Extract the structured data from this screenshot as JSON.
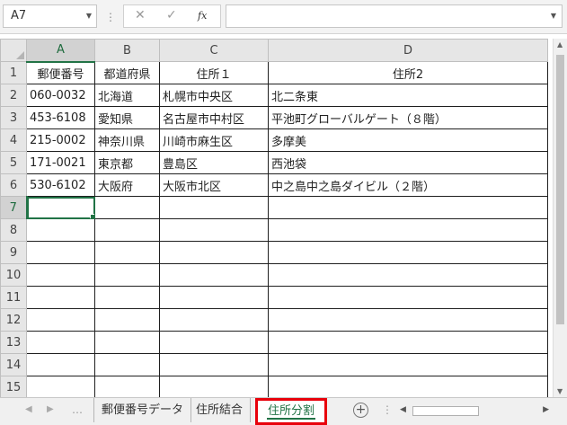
{
  "name_box": "A7",
  "formula_bar": {
    "cancel_icon": "✕",
    "enter_icon": "✓",
    "fx_label": "fx",
    "formula_value": ""
  },
  "columns": [
    "A",
    "B",
    "C",
    "D"
  ],
  "rows": [
    [
      "郵便番号",
      "都道府県",
      "住所１",
      "住所2"
    ],
    [
      "060-0032",
      "北海道",
      "札幌市中央区",
      "北二条東"
    ],
    [
      "453-6108",
      "愛知県",
      "名古屋市中村区",
      "平池町グローバルゲート（８階）"
    ],
    [
      "215-0002",
      "神奈川県",
      "川崎市麻生区",
      "多摩美"
    ],
    [
      "171-0021",
      "東京都",
      "豊島区",
      "西池袋"
    ],
    [
      "530-6102",
      "大阪府",
      "大阪市北区",
      "中之島中之島ダイビル（２階）"
    ],
    [
      "",
      "",
      "",
      ""
    ],
    [
      "",
      "",
      "",
      ""
    ],
    [
      "",
      "",
      "",
      ""
    ],
    [
      "",
      "",
      "",
      ""
    ],
    [
      "",
      "",
      "",
      ""
    ],
    [
      "",
      "",
      "",
      ""
    ],
    [
      "",
      "",
      "",
      ""
    ],
    [
      "",
      "",
      "",
      ""
    ],
    [
      "",
      "",
      "",
      ""
    ],
    [
      "",
      "",
      "",
      ""
    ]
  ],
  "sheet_tabs": [
    "郵便番号データ",
    "住所結合",
    "住所分割"
  ],
  "active_sheet": "住所分割",
  "active_cell": {
    "row": 7,
    "col": "A"
  },
  "colors": {
    "accent": "#217346",
    "highlight_box": "#e8000b"
  }
}
